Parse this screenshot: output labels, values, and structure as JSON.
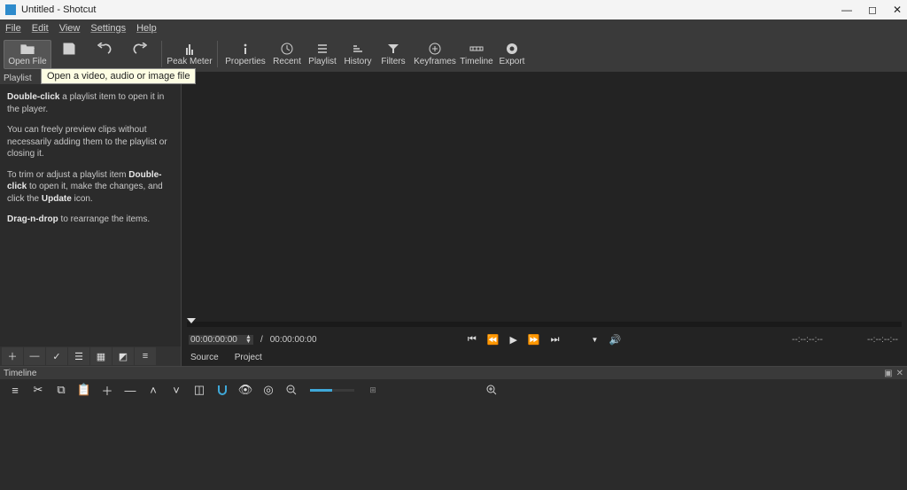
{
  "titlebar": {
    "title": "Untitled - Shotcut"
  },
  "menubar": {
    "file": "File",
    "edit": "Edit",
    "view": "View",
    "settings": "Settings",
    "help": "Help"
  },
  "toolbar": {
    "open_file": "Open File",
    "save": "Save",
    "undo": "Undo",
    "redo": "Redo",
    "peak_meter": "Peak Meter",
    "properties": "Properties",
    "recent": "Recent",
    "playlist": "Playlist",
    "history": "History",
    "filters": "Filters",
    "keyframes": "Keyframes",
    "timeline": "Timeline",
    "export": "Export",
    "tooltip": "Open a video, audio or image file"
  },
  "panels": {
    "playlist": {
      "title": "Playlist"
    },
    "timeline": {
      "title": "Timeline"
    }
  },
  "playlist_help": {
    "p1a": "Double-click",
    "p1b": " a playlist item to open it in the player.",
    "p2": "You can freely preview clips without necessarily adding them to the playlist or closing it.",
    "p3a": "To trim or adjust a playlist item ",
    "p3b": "Double-click",
    "p3c": " to open it, make the changes, and click the ",
    "p3d": "Update",
    "p3e": " icon.",
    "p4a": "Drag-n-drop",
    "p4b": " to rearrange the items."
  },
  "preview": {
    "time_current": "00:00:00:00",
    "time_sep": "/",
    "time_total": "00:00:00:00",
    "tc_a": "--:--:--:--",
    "tc_b": "--:--:--:--",
    "tabs": {
      "source": "Source",
      "project": "Project"
    }
  }
}
